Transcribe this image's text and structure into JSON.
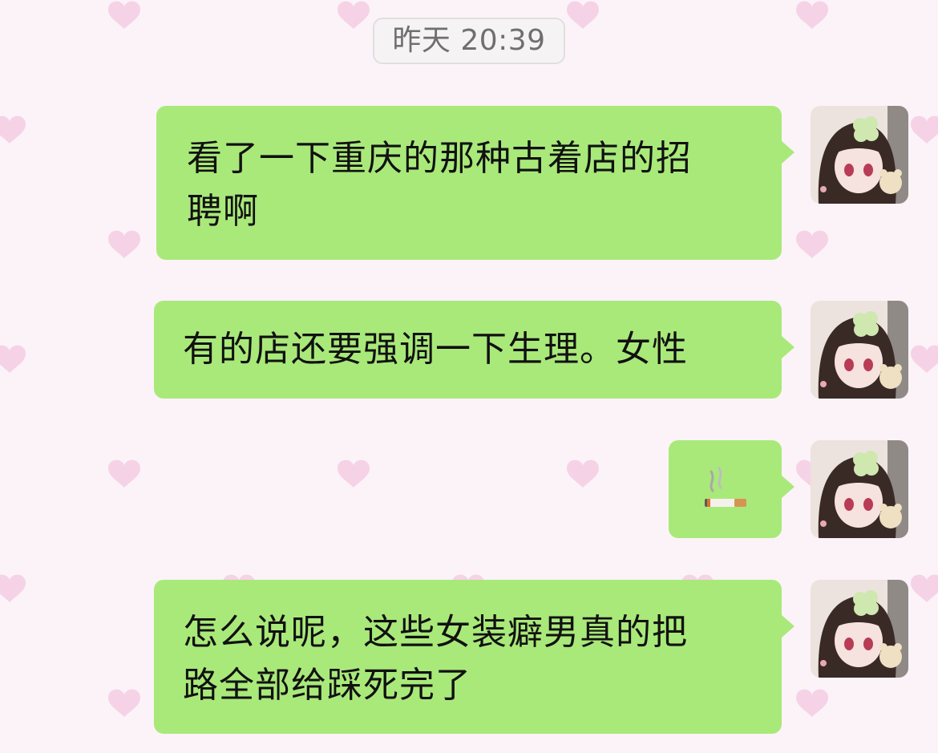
{
  "chat": {
    "timestamp": "昨天 20:39",
    "background_color": "#fbf3f8",
    "heart_color": "#f6d2e7",
    "bubble_color": "#a9e97a",
    "messages": [
      {
        "sender": "self",
        "text_lines": [
          "看了一下重庆的那种古着店的招",
          "聘啊"
        ]
      },
      {
        "sender": "self",
        "text_lines": [
          "有的店还要强调一下生理。女性"
        ]
      },
      {
        "sender": "self",
        "emoji": "🚬"
      },
      {
        "sender": "self",
        "text_lines": [
          "怎么说呢，这些女装癖男真的把",
          "路全部给踩死完了"
        ]
      }
    ],
    "avatar_icon": "doll-avatar-icon"
  }
}
